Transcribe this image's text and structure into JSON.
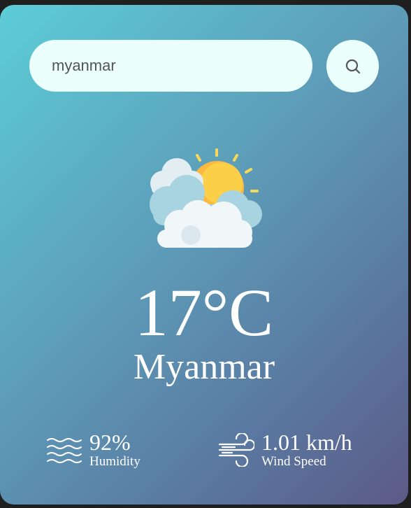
{
  "search": {
    "value": "myanmar",
    "button_icon": "search-icon"
  },
  "weather": {
    "icon": "partly-cloudy-icon",
    "temperature": "17°C",
    "city": "Myanmar"
  },
  "details": {
    "humidity": {
      "icon": "humidity-icon",
      "value": "92%",
      "label": "Humidity"
    },
    "wind": {
      "icon": "wind-icon",
      "value": "1.01 km/h",
      "label": "Wind Speed"
    }
  },
  "colors": {
    "gradient_start": "#5ccdd7",
    "gradient_end": "#5c5a87",
    "input_background": "#ebfffc",
    "text": "#ffffff"
  }
}
